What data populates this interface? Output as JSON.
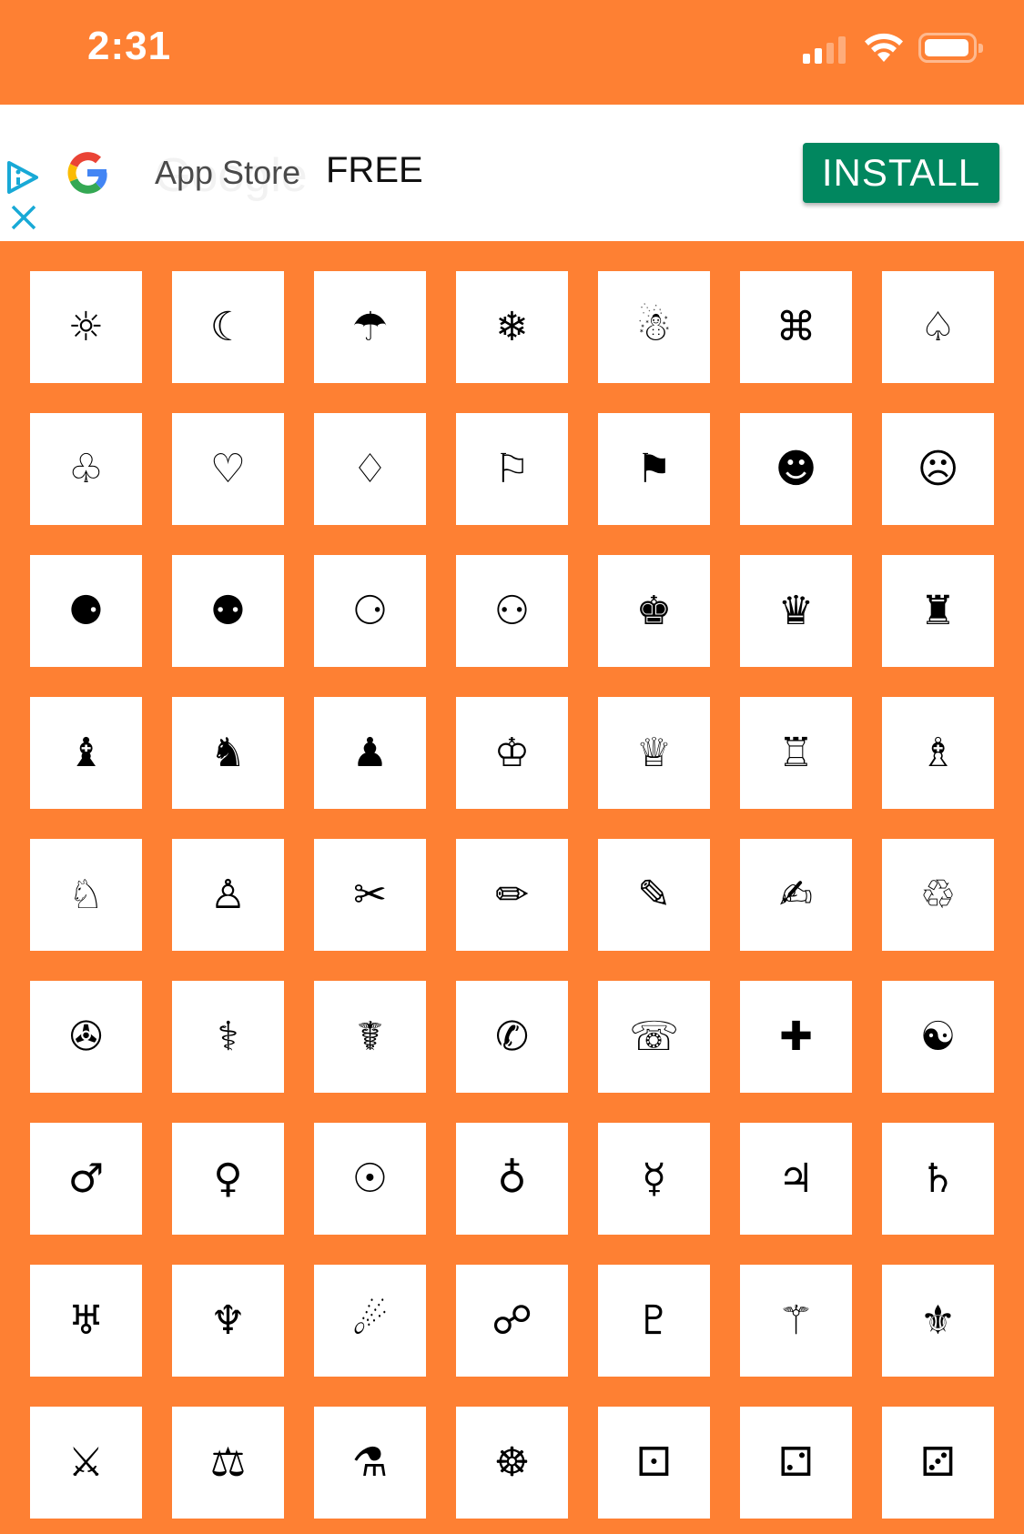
{
  "status_bar": {
    "time": "2:31",
    "signal_bars_active": 2,
    "signal_bars_total": 4,
    "battery_level": 0.9
  },
  "ad": {
    "title": "App Store",
    "watermark": "Google",
    "price": "FREE",
    "install_label": "INSTALL",
    "install_color": "#01875F"
  },
  "theme": {
    "background": "#FE8033",
    "tile": "#FFFFFF"
  },
  "symbols": [
    {
      "glyph": "☼",
      "name": "sun"
    },
    {
      "glyph": "☾",
      "name": "moon"
    },
    {
      "glyph": "☂",
      "name": "umbrella"
    },
    {
      "glyph": "❄",
      "name": "snowflake"
    },
    {
      "glyph": "☃",
      "name": "snowman"
    },
    {
      "glyph": "⌘",
      "name": "command"
    },
    {
      "glyph": "♤",
      "name": "spade"
    },
    {
      "glyph": "♧",
      "name": "club"
    },
    {
      "glyph": "♡",
      "name": "heart"
    },
    {
      "glyph": "♢",
      "name": "diamond"
    },
    {
      "glyph": "⚐",
      "name": "white-flag"
    },
    {
      "glyph": "⚑",
      "name": "black-flag"
    },
    {
      "glyph": "☻",
      "name": "smiley"
    },
    {
      "glyph": "☹",
      "name": "frowny"
    },
    {
      "glyph": "⚈",
      "name": "black-circle-white-dot"
    },
    {
      "glyph": "⚉",
      "name": "black-circle-two-white-dots"
    },
    {
      "glyph": "⚆",
      "name": "white-circle-dot"
    },
    {
      "glyph": "⚇",
      "name": "white-circle-two-dots"
    },
    {
      "glyph": "♚",
      "name": "black-king"
    },
    {
      "glyph": "♛",
      "name": "black-queen"
    },
    {
      "glyph": "♜",
      "name": "black-rook"
    },
    {
      "glyph": "♝",
      "name": "black-bishop"
    },
    {
      "glyph": "♞",
      "name": "black-knight"
    },
    {
      "glyph": "♟",
      "name": "black-pawn"
    },
    {
      "glyph": "♔",
      "name": "white-king"
    },
    {
      "glyph": "♕",
      "name": "white-queen"
    },
    {
      "glyph": "♖",
      "name": "white-rook"
    },
    {
      "glyph": "♗",
      "name": "white-bishop"
    },
    {
      "glyph": "♘",
      "name": "white-knight"
    },
    {
      "glyph": "♙",
      "name": "white-pawn"
    },
    {
      "glyph": "✂",
      "name": "scissors"
    },
    {
      "glyph": "✏",
      "name": "pencil"
    },
    {
      "glyph": "✎",
      "name": "pencil-lower-right"
    },
    {
      "glyph": "✍",
      "name": "writing-hand"
    },
    {
      "glyph": "♲",
      "name": "recycle"
    },
    {
      "glyph": "✇",
      "name": "tape-drive"
    },
    {
      "glyph": "⚕",
      "name": "staff-of-aesculapius"
    },
    {
      "glyph": "☤",
      "name": "caduceus"
    },
    {
      "glyph": "✆",
      "name": "telephone-location"
    },
    {
      "glyph": "☏",
      "name": "telephone"
    },
    {
      "glyph": "✚",
      "name": "heavy-cross"
    },
    {
      "glyph": "☯",
      "name": "yin-yang"
    },
    {
      "glyph": "♂",
      "name": "mars"
    },
    {
      "glyph": "♀",
      "name": "venus"
    },
    {
      "glyph": "☉",
      "name": "sun-astro"
    },
    {
      "glyph": "♁",
      "name": "earth"
    },
    {
      "glyph": "☿",
      "name": "mercury"
    },
    {
      "glyph": "♃",
      "name": "jupiter"
    },
    {
      "glyph": "♄",
      "name": "saturn"
    },
    {
      "glyph": "♅",
      "name": "uranus"
    },
    {
      "glyph": "♆",
      "name": "neptune"
    },
    {
      "glyph": "☄",
      "name": "comet"
    },
    {
      "glyph": "☍",
      "name": "opposition"
    },
    {
      "glyph": "♇",
      "name": "pluto"
    },
    {
      "glyph": "⚚",
      "name": "staff-of-hermes"
    },
    {
      "glyph": "⚜",
      "name": "fleur-de-lis"
    },
    {
      "glyph": "⚔",
      "name": "crossed-swords"
    },
    {
      "glyph": "⚖",
      "name": "scales"
    },
    {
      "glyph": "⚗",
      "name": "alembic"
    },
    {
      "glyph": "☸",
      "name": "dharma-wheel"
    },
    {
      "glyph": "⚀",
      "name": "die-face-1"
    },
    {
      "glyph": "⚁",
      "name": "die-face-2"
    },
    {
      "glyph": "⚂",
      "name": "die-face-3"
    }
  ]
}
